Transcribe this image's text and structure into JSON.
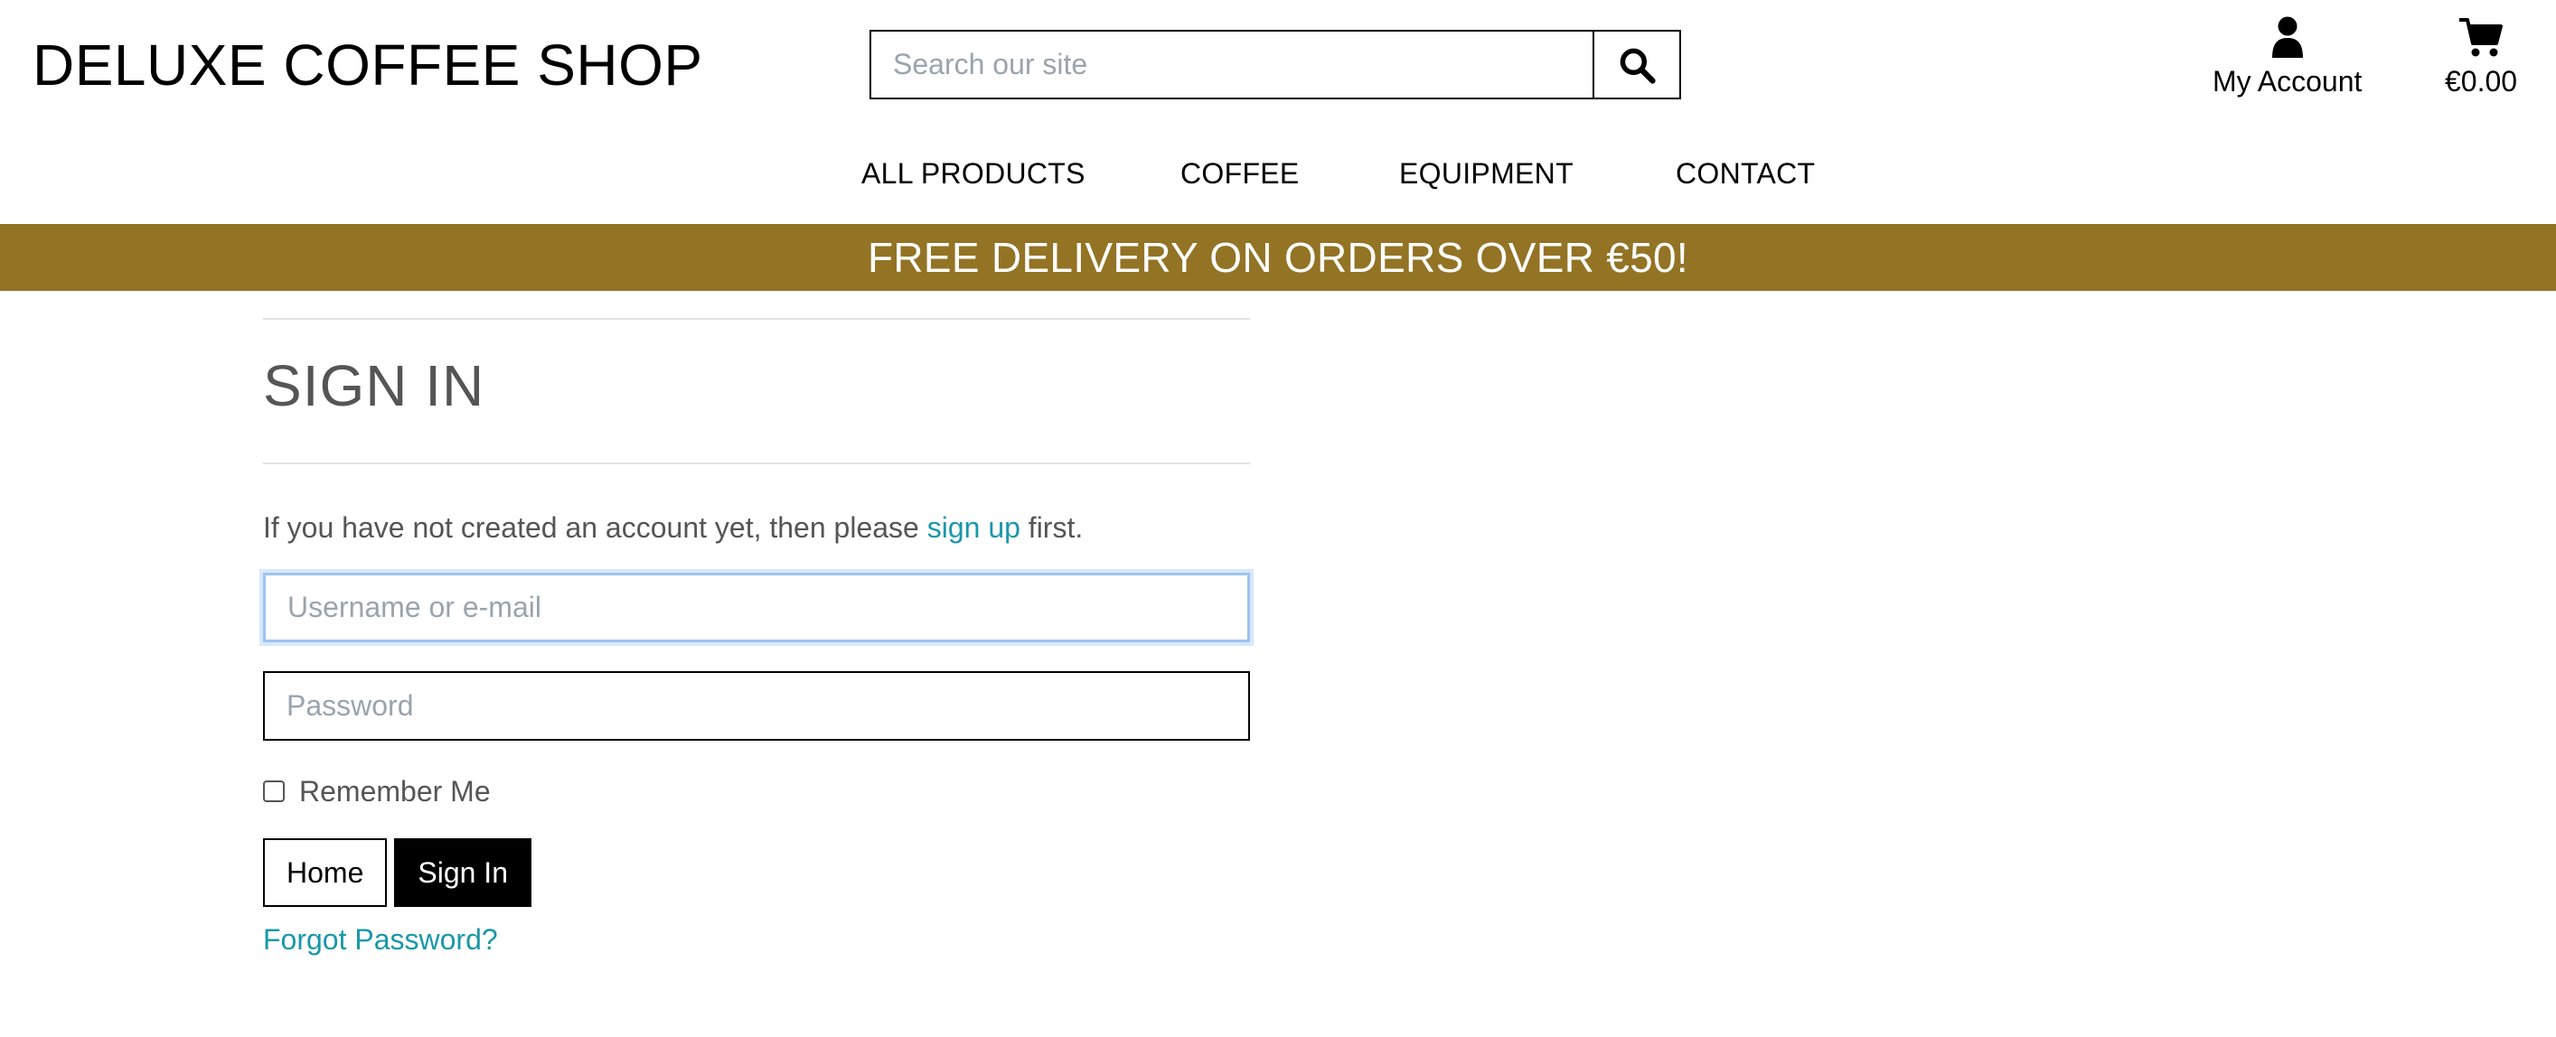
{
  "header": {
    "brand": "DELUXE COFFEE SHOP",
    "search": {
      "placeholder": "Search our site",
      "icon": "search-icon"
    },
    "account": {
      "label": "My Account",
      "icon": "user-icon"
    },
    "cart": {
      "total": "€0.00",
      "icon": "cart-icon"
    }
  },
  "nav": {
    "items": [
      {
        "label": "ALL PRODUCTS"
      },
      {
        "label": "COFFEE"
      },
      {
        "label": "EQUIPMENT"
      },
      {
        "label": "CONTACT"
      }
    ]
  },
  "banner": {
    "text": "FREE DELIVERY ON ORDERS OVER €50!"
  },
  "signin": {
    "title": "SIGN IN",
    "intro_before": "If you have not created an account yet, then please ",
    "intro_link": "sign up",
    "intro_after": " first.",
    "username_placeholder": "Username or e-mail",
    "password_placeholder": "Password",
    "remember_label": "Remember Me",
    "remember_checked": false,
    "home_button": "Home",
    "signin_button": "Sign In",
    "forgot_link": "Forgot Password?"
  },
  "colors": {
    "banner": "#937324",
    "link": "#1a98a8",
    "muted_text": "#555555",
    "focus_border": "#9fc2f2"
  }
}
